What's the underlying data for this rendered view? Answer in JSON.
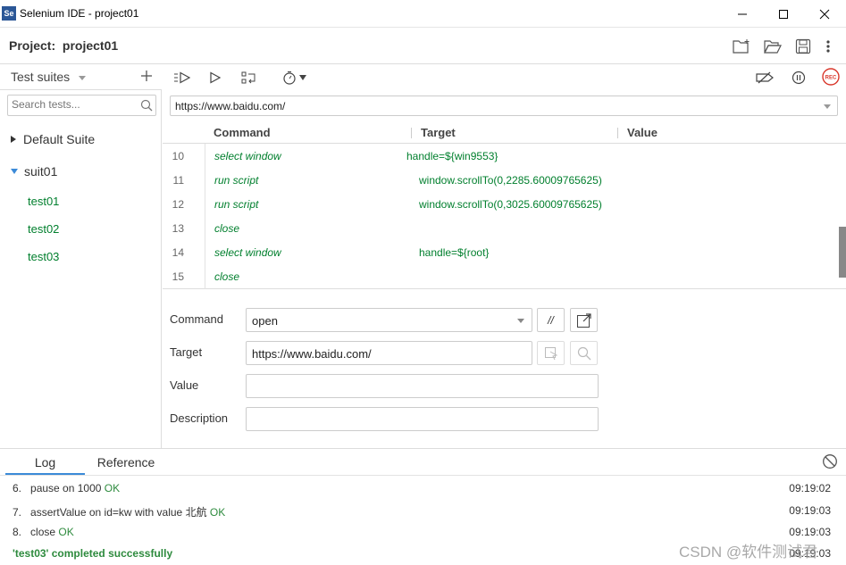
{
  "window": {
    "title": "Selenium IDE - project01",
    "logo": "Se"
  },
  "project": {
    "label": "Project:",
    "name": "project01"
  },
  "sidebar": {
    "suites_label": "Test suites",
    "search_placeholder": "Search tests...",
    "suites": [
      {
        "label": "Default Suite",
        "expanded": false
      },
      {
        "label": "suit01",
        "expanded": true,
        "tests": [
          "test01",
          "test02",
          "test03"
        ]
      }
    ]
  },
  "url": {
    "value": "https://www.baidu.com/"
  },
  "table": {
    "headers": {
      "command": "Command",
      "target": "Target",
      "value": "Value"
    },
    "rows": [
      {
        "num": "10",
        "command": "select window",
        "target": "handle=${win9553}",
        "value": ""
      },
      {
        "num": "11",
        "command": "run script",
        "target": "window.scrollTo(0,2285.60009765625)",
        "value": ""
      },
      {
        "num": "12",
        "command": "run script",
        "target": "window.scrollTo(0,3025.60009765625)",
        "value": ""
      },
      {
        "num": "13",
        "command": "close",
        "target": "",
        "value": ""
      },
      {
        "num": "14",
        "command": "select window",
        "target": "handle=${root}",
        "value": ""
      },
      {
        "num": "15",
        "command": "close",
        "target": "",
        "value": ""
      }
    ]
  },
  "editor": {
    "command_label": "Command",
    "command_value": "open",
    "comment_toggle": "//",
    "target_label": "Target",
    "target_value": "https://www.baidu.com/",
    "value_label": "Value",
    "value_value": "",
    "description_label": "Description",
    "description_value": ""
  },
  "log": {
    "tabs": [
      "Log",
      "Reference"
    ],
    "entries": [
      {
        "num": "6.",
        "text": "pause on 1000",
        "status": "OK",
        "time": "09:19:02"
      },
      {
        "num": "7.",
        "text": "assertValue on id=kw with value 北航",
        "status": "OK",
        "time": "09:19:03"
      },
      {
        "num": "8.",
        "text": "close",
        "status": "OK",
        "time": "09:19:03"
      }
    ],
    "completed": "'test03' completed successfully",
    "completed_time": "09:19:03"
  },
  "watermark": "CSDN @软件测试君",
  "colors": {
    "accent": "#3b8ad8",
    "ok_green": "#2e8b3e",
    "command_green": "#007f2d",
    "rec_red": "#d9382c"
  }
}
